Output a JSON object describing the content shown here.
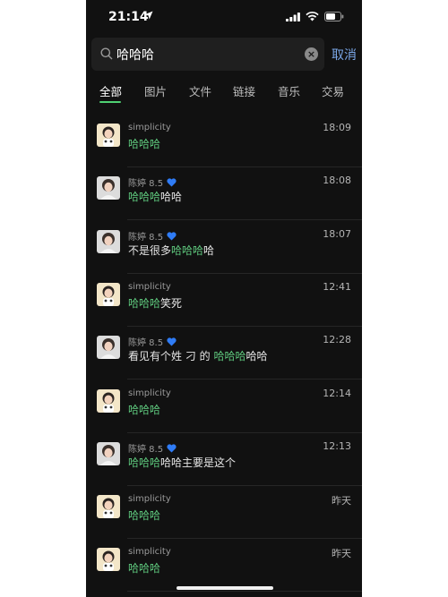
{
  "status_bar": {
    "time": "21:14"
  },
  "search": {
    "query": "哈哈哈",
    "clear_symbol": "×",
    "cancel_label": "取消"
  },
  "tabs": [
    {
      "label": "全部",
      "active": true
    },
    {
      "label": "图片",
      "active": false
    },
    {
      "label": "文件",
      "active": false
    },
    {
      "label": "链接",
      "active": false
    },
    {
      "label": "音乐",
      "active": false
    },
    {
      "label": "交易",
      "active": false
    }
  ],
  "colors": {
    "highlight": "#5fc97e",
    "accent_underline": "#4fd173",
    "cancel": "#7aa6e6",
    "heart": "#2f7cf6"
  },
  "results": [
    {
      "sender": "simplicity",
      "heart": false,
      "time": "18:09",
      "pre": "",
      "match": "哈哈哈",
      "post": ""
    },
    {
      "sender": "陈婷 8.5",
      "heart": true,
      "time": "18:08",
      "pre": "",
      "match": "哈哈哈",
      "post": "哈哈"
    },
    {
      "sender": "陈婷 8.5",
      "heart": true,
      "time": "18:07",
      "pre": "不是很多",
      "match": "哈哈哈",
      "post": "哈"
    },
    {
      "sender": "simplicity",
      "heart": false,
      "time": "12:41",
      "pre": "",
      "match": "哈哈哈",
      "post": "笑死"
    },
    {
      "sender": "陈婷 8.5",
      "heart": true,
      "time": "12:28",
      "pre": "看见有个姓 刁 的 ",
      "match": "哈哈哈",
      "post": "哈哈"
    },
    {
      "sender": "simplicity",
      "heart": false,
      "time": "12:14",
      "pre": "",
      "match": "哈哈哈",
      "post": ""
    },
    {
      "sender": "陈婷 8.5",
      "heart": true,
      "time": "12:13",
      "pre": "",
      "match": "哈哈哈",
      "post": "哈哈主要是这个"
    },
    {
      "sender": "simplicity",
      "heart": false,
      "time": "昨天",
      "pre": "",
      "match": "哈哈哈",
      "post": ""
    },
    {
      "sender": "simplicity",
      "heart": false,
      "time": "昨天",
      "pre": "",
      "match": "哈哈哈",
      "post": ""
    }
  ]
}
